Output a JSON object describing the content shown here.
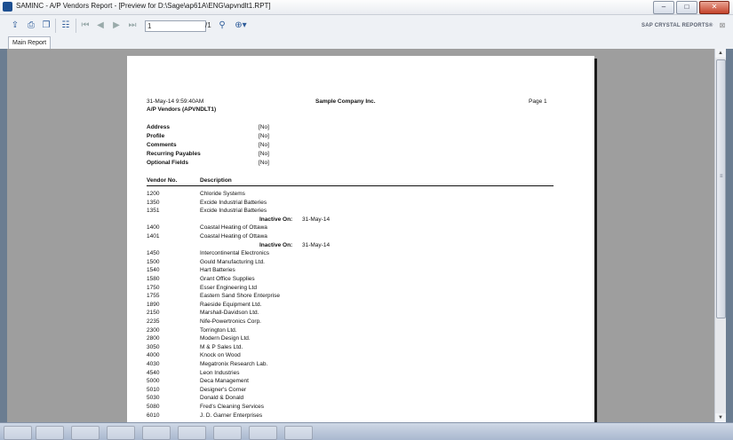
{
  "window": {
    "title": "SAMINC - A/P Vendors Report - [Preview for D:\\Sage\\ap61A\\ENG\\apvndlt1.RPT]",
    "buttons": {
      "minimize": "–",
      "maximize": "□",
      "close": "✕"
    }
  },
  "toolbar": {
    "page_value": "1",
    "page_total": "/1",
    "brand": "SAP CRYSTAL REPORTS®",
    "icons": [
      "export-icon",
      "print-icon",
      "copy-icon",
      "group-tree-icon",
      "first-page-icon",
      "prev-page-icon",
      "next-page-icon",
      "last-page-icon",
      "find-icon",
      "zoom-icon"
    ]
  },
  "tabs": [
    {
      "label": "Main Report"
    }
  ],
  "report": {
    "header": {
      "datetime": "31-May-14  9:59:40AM",
      "company": "Sample Company Inc.",
      "page": "Page 1",
      "title": "A/P Vendors (APVNDLT1)"
    },
    "options": [
      {
        "label": "Address",
        "value": "[No]"
      },
      {
        "label": "Profile",
        "value": "[No]"
      },
      {
        "label": "Comments",
        "value": "[No]"
      },
      {
        "label": "Recurring Payables",
        "value": "[No]"
      },
      {
        "label": "Optional Fields",
        "value": "[No]"
      }
    ],
    "columns": {
      "vendor_no": "Vendor No.",
      "description": "Description"
    },
    "rows": [
      {
        "kind": "vendor",
        "no": "1200",
        "desc": "Chloride Systems"
      },
      {
        "kind": "vendor",
        "no": "1350",
        "desc": "Excide Industrial Batteries"
      },
      {
        "kind": "vendor",
        "no": "1351",
        "desc": "Excide Industrial Batteries"
      },
      {
        "kind": "inactive",
        "label": "Inactive On:",
        "date": "31-May-14"
      },
      {
        "kind": "vendor",
        "no": "1400",
        "desc": "Coastal Heating of Ottawa"
      },
      {
        "kind": "vendor",
        "no": "1401",
        "desc": "Coastal Heating of Ottawa"
      },
      {
        "kind": "inactive",
        "label": "Inactive On:",
        "date": "31-May-14"
      },
      {
        "kind": "vendor",
        "no": "1450",
        "desc": "Intercontinental Electronics"
      },
      {
        "kind": "vendor",
        "no": "1500",
        "desc": "Gould Manufacturing Ltd."
      },
      {
        "kind": "vendor",
        "no": "1540",
        "desc": "Hart Batteries"
      },
      {
        "kind": "vendor",
        "no": "1580",
        "desc": "Grant Office Supplies"
      },
      {
        "kind": "vendor",
        "no": "1750",
        "desc": "Esser Engineering Ltd"
      },
      {
        "kind": "vendor",
        "no": "1755",
        "desc": "Eastern Sand Shore Enterprise"
      },
      {
        "kind": "vendor",
        "no": "1890",
        "desc": "Raeside Equipment Ltd."
      },
      {
        "kind": "vendor",
        "no": "2150",
        "desc": "Marshall-Davidson Ltd."
      },
      {
        "kind": "vendor",
        "no": "2235",
        "desc": "Nife-Powertronics Corp."
      },
      {
        "kind": "vendor",
        "no": "2300",
        "desc": "Torrington Ltd."
      },
      {
        "kind": "vendor",
        "no": "2800",
        "desc": "Modern Design Ltd."
      },
      {
        "kind": "vendor",
        "no": "3050",
        "desc": "M & P Sales Ltd."
      },
      {
        "kind": "vendor",
        "no": "4000",
        "desc": "Knock on Wood"
      },
      {
        "kind": "vendor",
        "no": "4030",
        "desc": "Megatronix Research Lab."
      },
      {
        "kind": "vendor",
        "no": "4540",
        "desc": "Leon Industries"
      },
      {
        "kind": "vendor",
        "no": "5000",
        "desc": "Deca Management"
      },
      {
        "kind": "vendor",
        "no": "5010",
        "desc": "Designer's Corner"
      },
      {
        "kind": "vendor",
        "no": "5030",
        "desc": "Donald & Donald"
      },
      {
        "kind": "vendor",
        "no": "5080",
        "desc": "Fred's Cleaning Services"
      },
      {
        "kind": "vendor",
        "no": "6010",
        "desc": "J. D. Garner Enterprises"
      }
    ]
  },
  "colors": {
    "viewer_bg": "#9e9e9e",
    "accent": "#2f5d9a"
  }
}
